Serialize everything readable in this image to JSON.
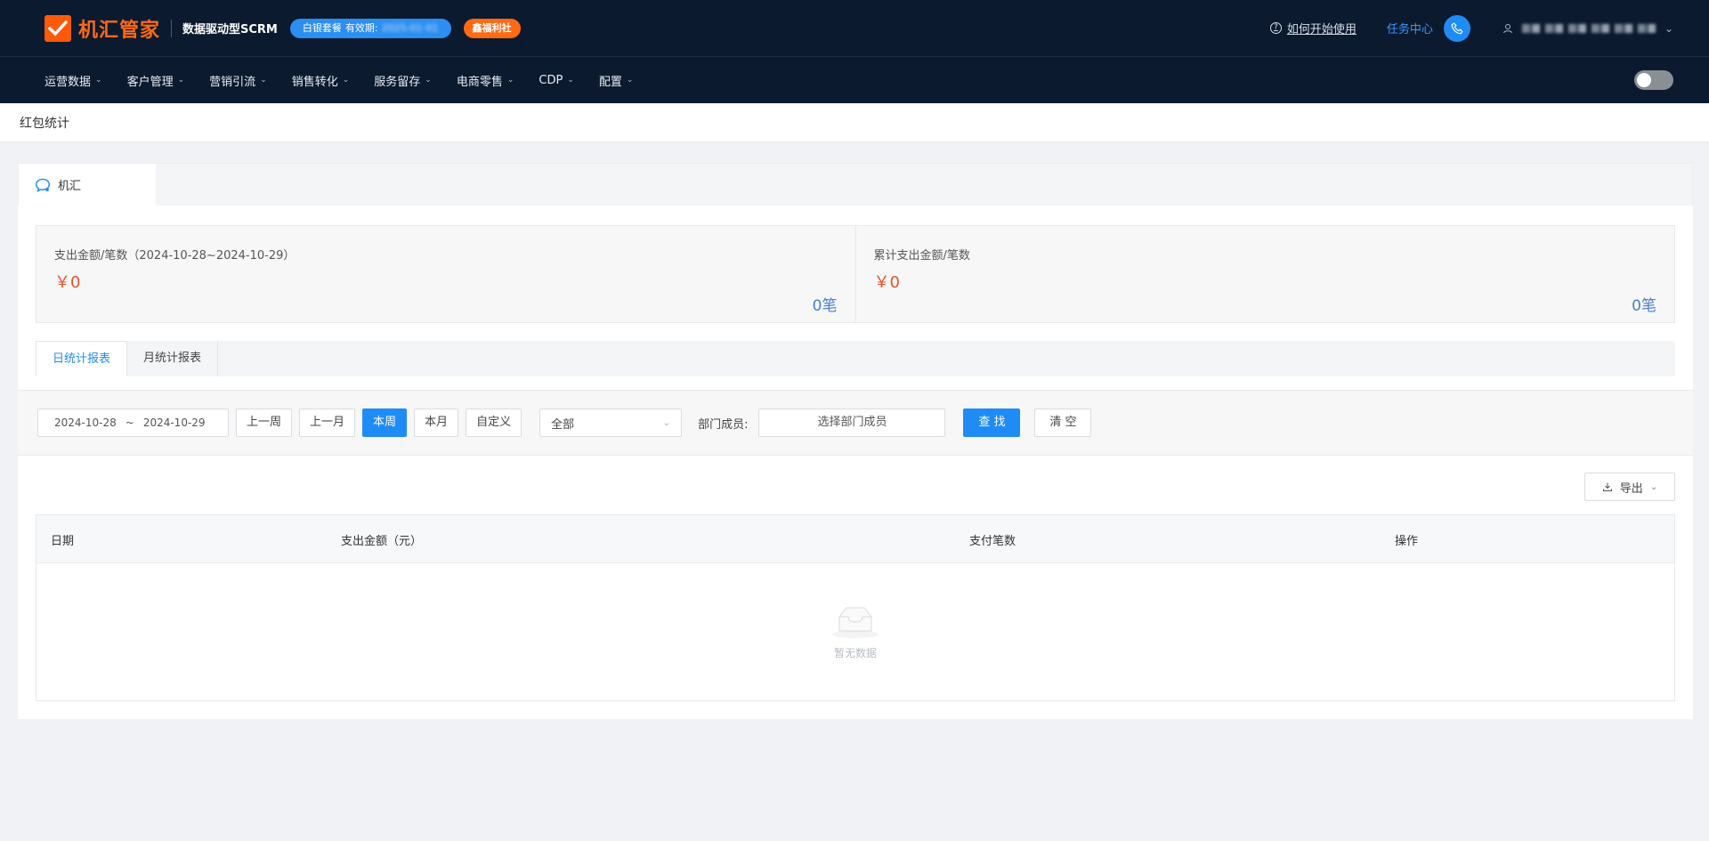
{
  "header": {
    "logo_text": "机汇管家",
    "subtitle": "数据驱动型SCRM",
    "package_label": "白银套餐",
    "expire_label": "有效期:",
    "expire_value": "2025-01-01",
    "welfare_label": "鑫福利社",
    "help_label": "如何开始使用",
    "task_center_label": "任务中心",
    "user_name": "user account"
  },
  "nav": {
    "items": [
      {
        "label": "运营数据"
      },
      {
        "label": "客户管理"
      },
      {
        "label": "营销引流"
      },
      {
        "label": "销售转化"
      },
      {
        "label": "服务留存"
      },
      {
        "label": "电商零售"
      },
      {
        "label": "CDP"
      },
      {
        "label": "配置"
      }
    ]
  },
  "breadcrumb": {
    "title": "红包统计"
  },
  "main_tab": {
    "label": "机汇"
  },
  "stats": {
    "period": {
      "label": "支出金额/笔数（2024-10-28~2024-10-29）",
      "amount": "￥0",
      "count": "0笔"
    },
    "total": {
      "label": "累计支出金额/笔数",
      "amount": "￥0",
      "count": "0笔"
    }
  },
  "report_tabs": [
    {
      "label": "日统计报表",
      "active": true
    },
    {
      "label": "月统计报表",
      "active": false
    }
  ],
  "filter": {
    "date_start": "2024-10-28",
    "date_sep": "~",
    "date_end": "2024-10-29",
    "buttons": {
      "last_week": "上一周",
      "last_month": "上一月",
      "this_week": "本周",
      "this_month": "本月",
      "custom": "自定义"
    },
    "select_value": "全部",
    "dept_label": "部门成员:",
    "dept_placeholder": "选择部门成员",
    "search_label": "查 找",
    "clear_label": "清 空"
  },
  "export_label": "导出",
  "table": {
    "columns": [
      "日期",
      "支出金额（元）",
      "支付笔数",
      "操作"
    ],
    "rows": [],
    "empty_text": "暂无数据"
  },
  "colors": {
    "topbar_bg": "#0b1a2e",
    "accent_blue": "#1f8cf5",
    "brand_orange": "#ff6a14",
    "amount_red": "#e9522b"
  }
}
